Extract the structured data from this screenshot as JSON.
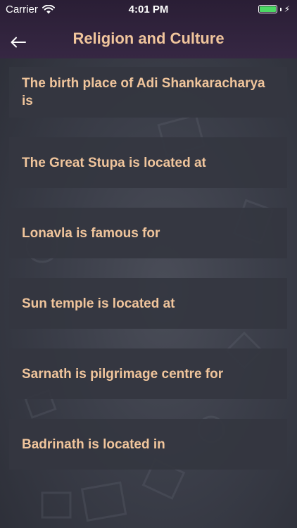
{
  "status_bar": {
    "carrier": "Carrier",
    "time": "4:01 PM"
  },
  "header": {
    "title": "Religion and Culture",
    "back_icon": "arrow-left-icon"
  },
  "questions": [
    {
      "text": "The birth place of Adi Shankaracharya is"
    },
    {
      "text": "The Great Stupa is located at"
    },
    {
      "text": "Lonavla is famous for"
    },
    {
      "text": "Sun temple is located at"
    },
    {
      "text": "Sarnath is pilgrimage centre for"
    },
    {
      "text": "Badrinath is located in"
    }
  ],
  "colors": {
    "header_bg": "#2a1e35",
    "accent_text": "#f0c59c",
    "card_bg": "#343640",
    "battery": "#4cd964"
  }
}
